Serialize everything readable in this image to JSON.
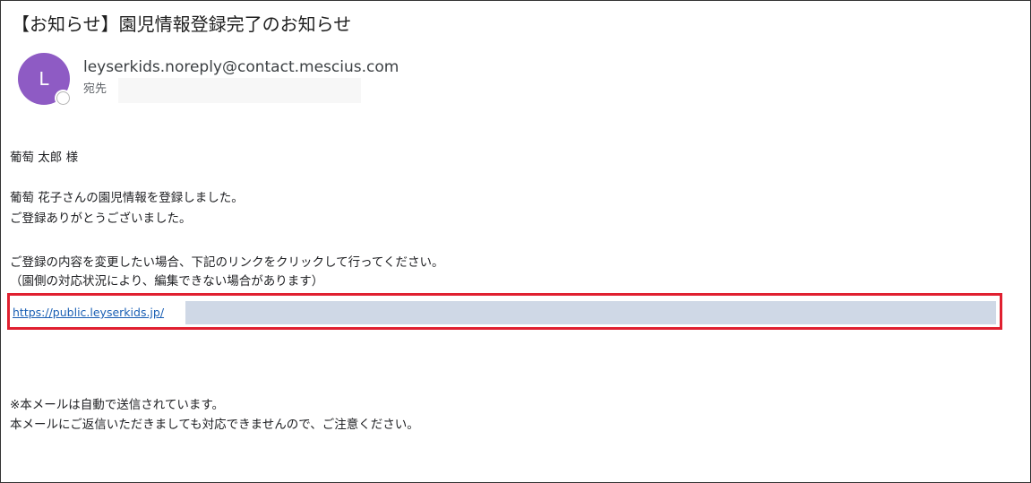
{
  "email": {
    "subject": "【お知らせ】園児情報登録完了のお知らせ",
    "avatar_initial": "L",
    "sender": "leyserkids.noreply@contact.mescius.com",
    "to_label": "宛先",
    "salutation": "葡萄 太郎 様",
    "body_line1": "葡萄 花子さんの園児情報を登録しました。",
    "body_line2": "ご登録ありがとうございました。",
    "body_line3": "ご登録の内容を変更したい場合、下記のリンクをクリックして行ってください。",
    "body_line4": "（園側の対応状況により、編集できない場合があります）",
    "link_text": "https://public.leyserkids.jp/",
    "footer_line1": "※本メールは自動で送信されています。",
    "footer_line2": "本メールにご返信いただきましても対応できませんので、ご注意ください。"
  },
  "colors": {
    "avatar": "#8e5bc4",
    "highlight_border": "#e02030",
    "link": "#1a5fb4",
    "redaction": "#cfd8e6"
  }
}
